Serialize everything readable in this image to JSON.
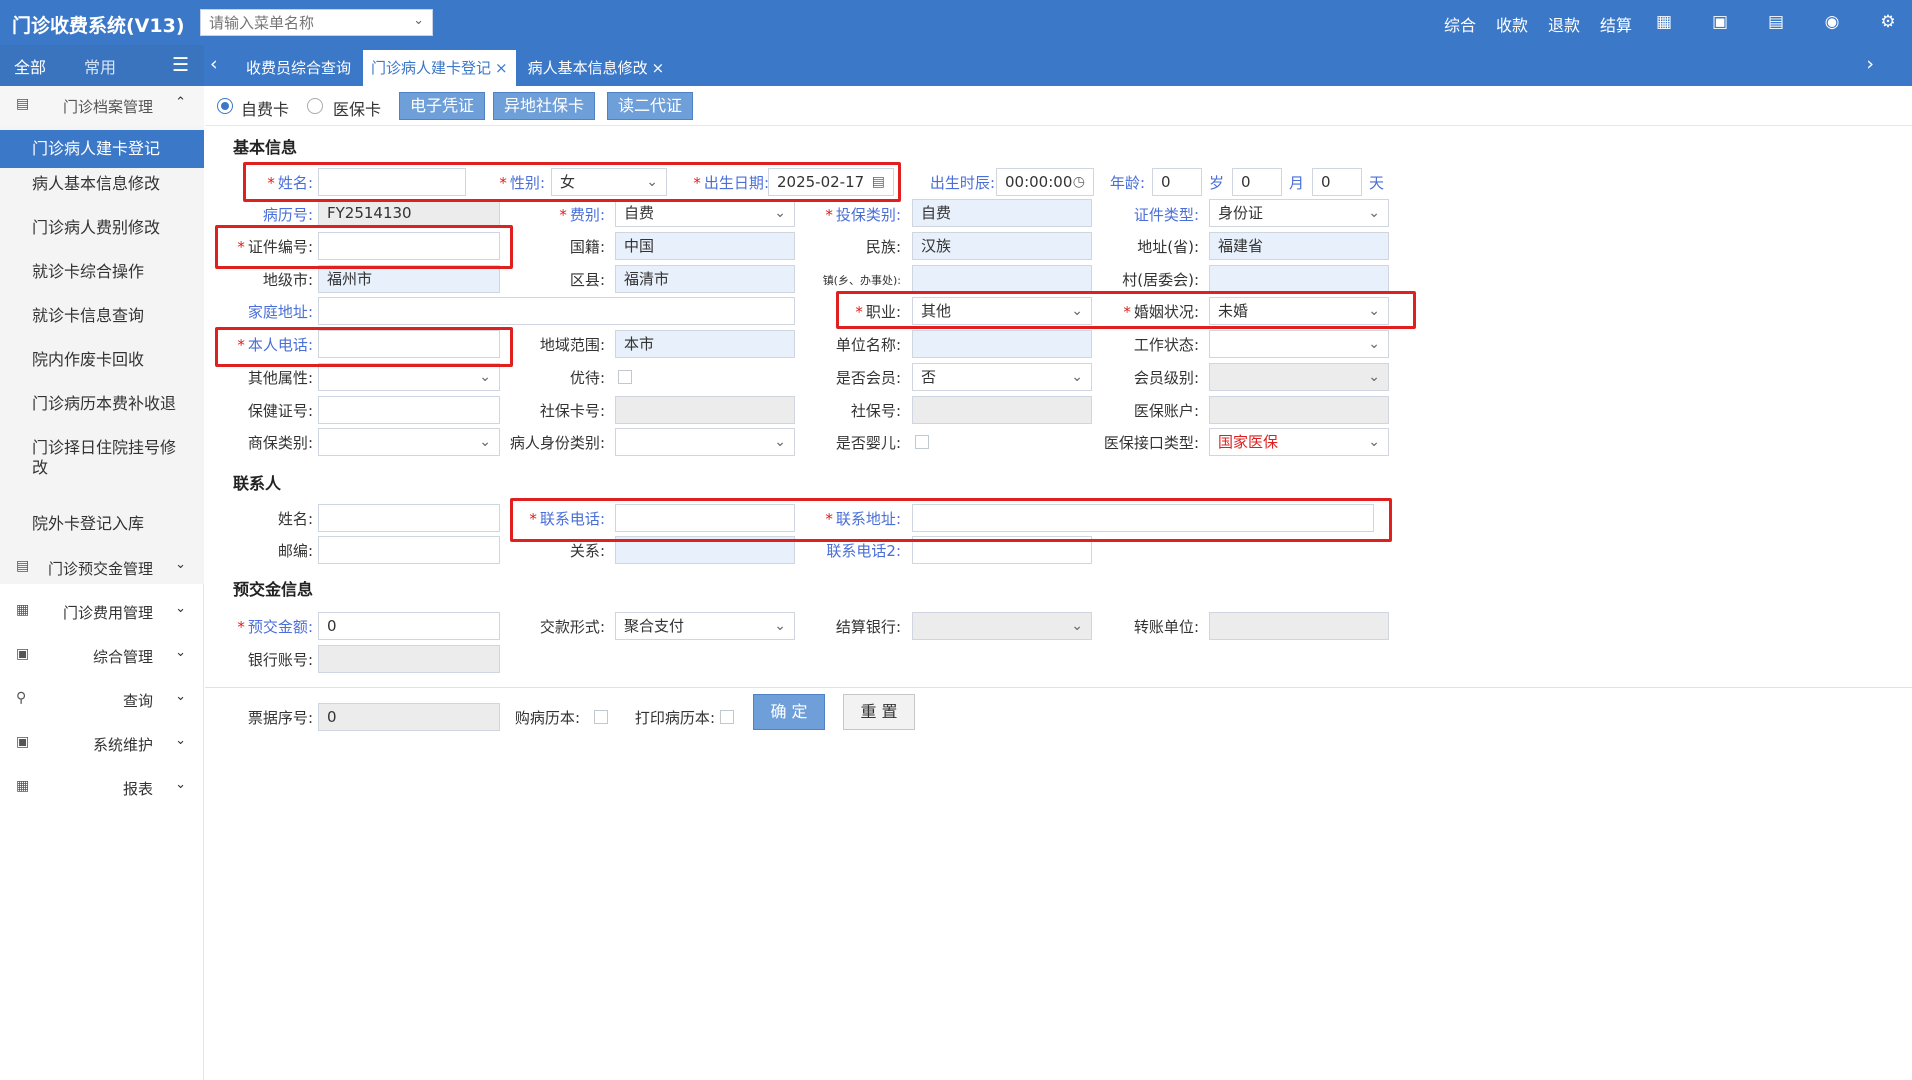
{
  "app": {
    "title": "门诊收费系统(V13)"
  },
  "menu_search": {
    "placeholder": "请输入菜单名称"
  },
  "top_actions": [
    "综合",
    "收款",
    "退款",
    "结算"
  ],
  "side_tabs": {
    "all": "全部",
    "common": "常用"
  },
  "tabs": [
    {
      "label": "收费员综合查询",
      "closable": false
    },
    {
      "label": "门诊病人建卡登记",
      "closable": true,
      "active": true
    },
    {
      "label": "病人基本信息修改",
      "closable": true
    }
  ],
  "sidebar": {
    "groups": [
      {
        "label": "门诊档案管理",
        "open": true
      },
      {
        "label": "门诊预交金管理"
      },
      {
        "label": "门诊费用管理"
      },
      {
        "label": "综合管理"
      },
      {
        "label": "查询"
      },
      {
        "label": "系统维护"
      },
      {
        "label": "报表"
      }
    ],
    "items": [
      "门诊病人建卡登记",
      "病人基本信息修改",
      "门诊病人费别修改",
      "就诊卡综合操作",
      "就诊卡信息查询",
      "院内作废卡回收",
      "门诊病历本费补收退",
      "门诊择日住院挂号修改",
      "院外卡登记入库"
    ]
  },
  "toolbar": {
    "radio_self": "自费卡",
    "radio_insurance": "医保卡",
    "btn_e_voucher": "电子凭证",
    "btn_remote_card": "异地社保卡",
    "btn_read_id": "读二代证"
  },
  "sections": {
    "basic": "基本信息",
    "contact": "联系人",
    "deposit": "预交金信息"
  },
  "labels": {
    "name": "姓名",
    "gender": "性别",
    "birth_date": "出生日期",
    "birth_time": "出生时辰",
    "age": "年龄",
    "unit_year": "岁",
    "unit_month": "月",
    "unit_day": "天",
    "record_no": "病历号",
    "fee_type": "费别",
    "insure_type": "投保类别",
    "id_type": "证件类型",
    "id_no": "证件编号",
    "nationality": "国籍",
    "ethnicity": "民族",
    "address_province": "地址(省)",
    "city": "地级市",
    "county": "区县",
    "town": "镇(乡、办事处)",
    "village": "村(居委会)",
    "home_address": "家庭地址",
    "occupation": "职业",
    "marital": "婚姻状况",
    "phone": "本人电话",
    "region": "地域范围",
    "employer": "单位名称",
    "work_status": "工作状态",
    "other_attr": "其他属性",
    "priority": "优待",
    "is_member": "是否会员",
    "member_level": "会员级别",
    "health_no": "保健证号",
    "social_card": "社保卡号",
    "social_no": "社保号",
    "insurance_account": "医保账户",
    "commercial": "商保类别",
    "identity_type": "病人身份类别",
    "is_infant": "是否婴儿",
    "insurance_api": "医保接口类型",
    "contact_name": "姓名",
    "contact_phone": "联系电话",
    "contact_address": "联系地址",
    "zip": "邮编",
    "relation": "关系",
    "contact_phone2": "联系电话2",
    "deposit_amount": "预交金额",
    "pay_method": "交款形式",
    "settle_bank": "结算银行",
    "transfer_unit": "转账单位",
    "bank_account": "银行账号",
    "receipt_no": "票据序号",
    "buy_record_book": "购病历本",
    "print_record_book": "打印病历本"
  },
  "values": {
    "gender": "女",
    "birth_date": "2025-02-17",
    "birth_time": "00:00:00",
    "age_year": "0",
    "age_month": "0",
    "age_day": "0",
    "record_no": "FY2514130",
    "fee_type": "自费",
    "insure_type": "自费",
    "id_type": "身份证",
    "nationality": "中国",
    "ethnicity": "汉族",
    "province": "福建省",
    "city": "福州市",
    "county": "福清市",
    "occupation": "其他",
    "marital": "未婚",
    "region": "本市",
    "is_member": "否",
    "insurance_api": "国家医保",
    "deposit_amount": "0",
    "pay_method": "聚合支付",
    "receipt_no": "0"
  },
  "buttons": {
    "ok": "确 定",
    "reset": "重 置"
  }
}
